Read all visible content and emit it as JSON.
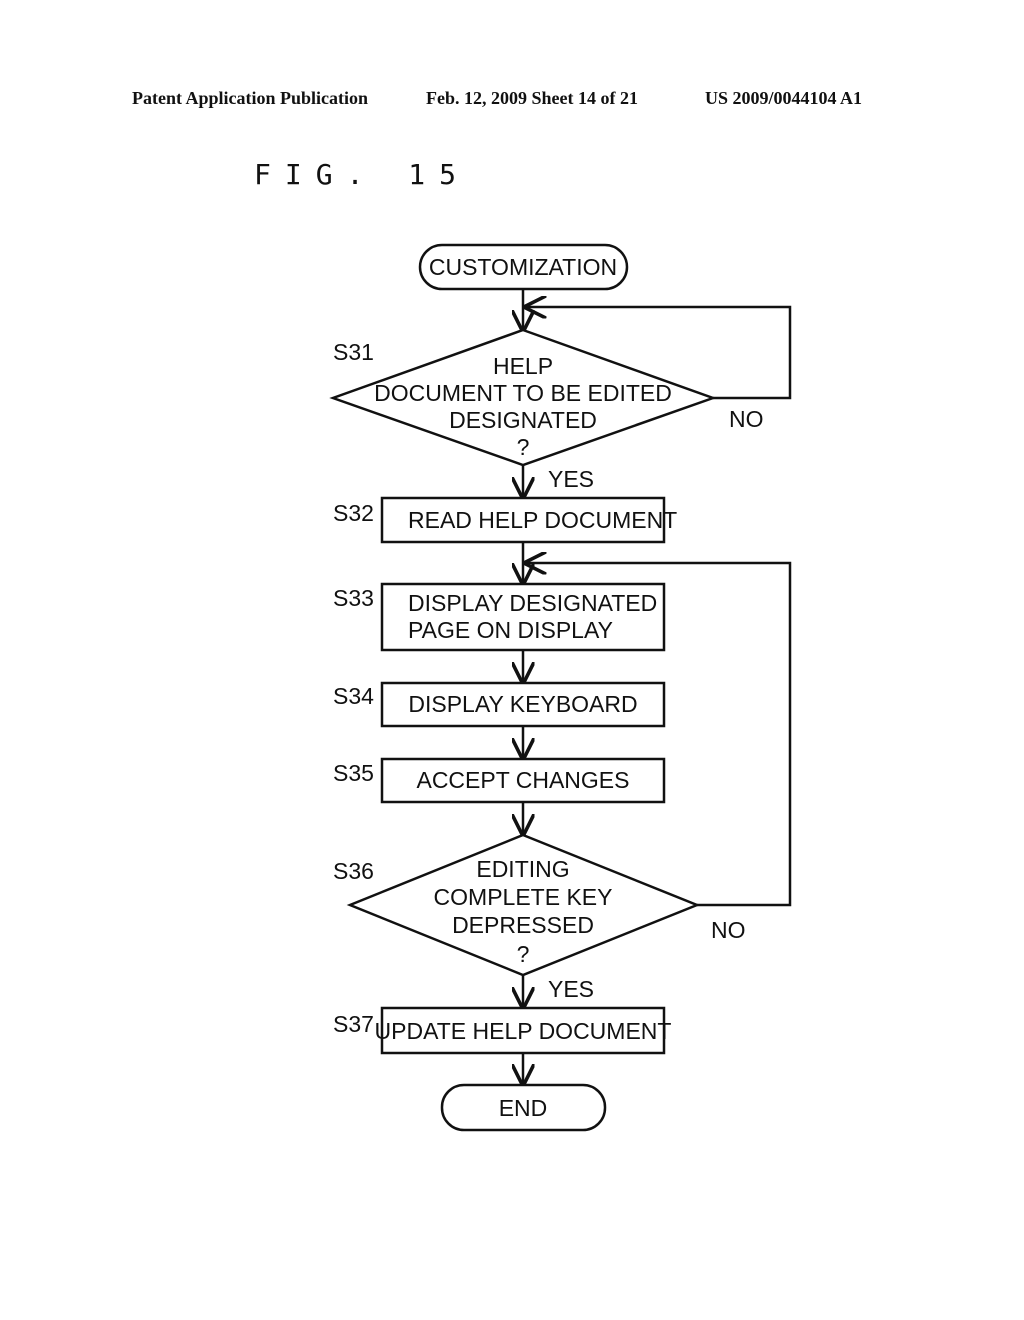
{
  "header": {
    "publication": "Patent Application Publication",
    "date_sheet": "Feb. 12, 2009   Sheet 14 of 21",
    "number": "US 2009/0044104 A1"
  },
  "figure_label": "FIG. 15",
  "flowchart": {
    "start": "CUSTOMIZATION",
    "end": "END",
    "steps": [
      {
        "id": "S31",
        "type": "decision",
        "lines": [
          "HELP",
          "DOCUMENT TO BE EDITED",
          "DESIGNATED",
          "?"
        ],
        "yes": "YES",
        "no": "NO"
      },
      {
        "id": "S32",
        "type": "process",
        "lines": [
          "READ HELP DOCUMENT"
        ]
      },
      {
        "id": "S33",
        "type": "process",
        "lines": [
          "DISPLAY DESIGNATED",
          "PAGE ON DISPLAY"
        ]
      },
      {
        "id": "S34",
        "type": "process",
        "lines": [
          "DISPLAY KEYBOARD"
        ]
      },
      {
        "id": "S35",
        "type": "process",
        "lines": [
          "ACCEPT CHANGES"
        ]
      },
      {
        "id": "S36",
        "type": "decision",
        "lines": [
          "EDITING",
          "COMPLETE KEY",
          "DEPRESSED",
          "?"
        ],
        "yes": "YES",
        "no": "NO"
      },
      {
        "id": "S37",
        "type": "process",
        "lines": [
          "UPDATE HELP DOCUMENT"
        ]
      }
    ]
  }
}
